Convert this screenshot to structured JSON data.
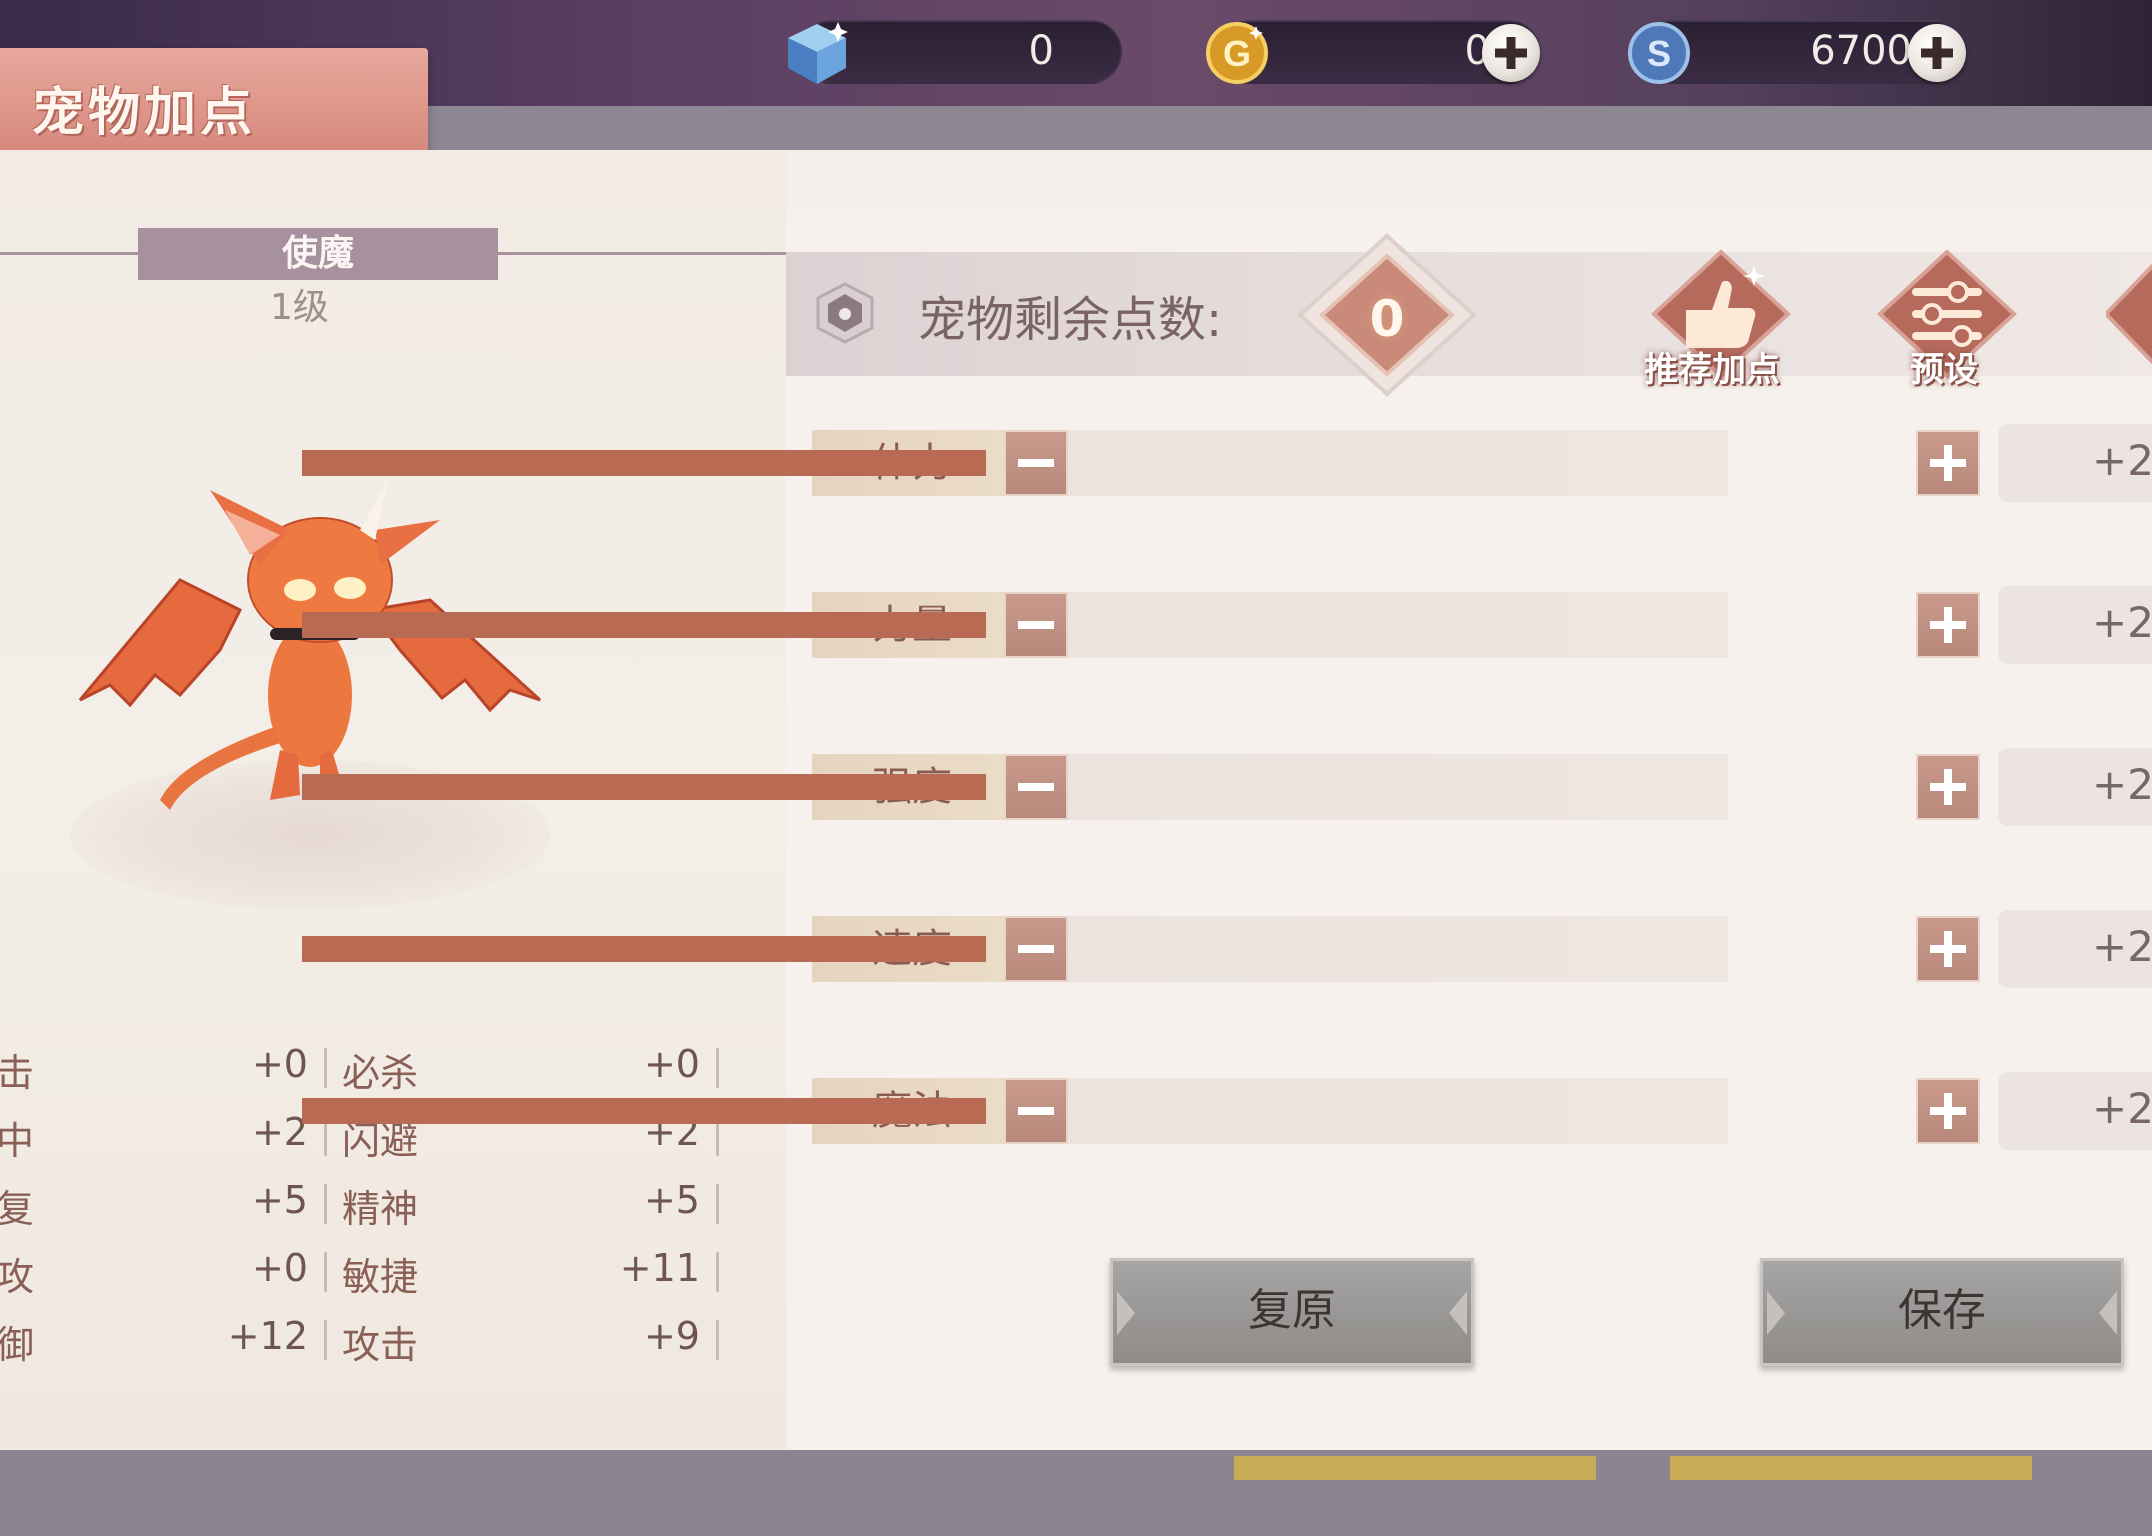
{
  "header": {
    "title": "宠物加点"
  },
  "currencies": [
    {
      "icon": "diamond-cube-icon",
      "value": "0",
      "has_plus": false
    },
    {
      "icon": "gold-coin-icon",
      "value": "0",
      "has_plus": true
    },
    {
      "icon": "silver-coin-icon",
      "value": "6700",
      "has_plus": true
    }
  ],
  "pet": {
    "name": "使魔",
    "level": "1级"
  },
  "stats": [
    {
      "left_label": "击",
      "left_value": "+0",
      "right_label": "必杀",
      "right_value": "+0"
    },
    {
      "left_label": "中",
      "left_value": "+2",
      "right_label": "闪避",
      "right_value": "+2"
    },
    {
      "left_label": "复",
      "left_value": "+5",
      "right_label": "精神",
      "right_value": "+5"
    },
    {
      "left_label": "攻",
      "left_value": "+0",
      "right_label": "敏捷",
      "right_value": "+11"
    },
    {
      "left_label": "御",
      "left_value": "+12",
      "right_label": "攻击",
      "right_value": "+9"
    }
  ],
  "points": {
    "label": "宠物剩余点数:",
    "value": "0"
  },
  "actions": {
    "recommend_label": "推荐加点",
    "preset_label": "预设"
  },
  "attributes": [
    {
      "label": "体力",
      "bonus": "+2"
    },
    {
      "label": "力量",
      "bonus": "+2"
    },
    {
      "label": "强度",
      "bonus": "+2"
    },
    {
      "label": "速度",
      "bonus": "+2"
    },
    {
      "label": "魔法",
      "bonus": "+2"
    }
  ],
  "buttons": {
    "reset_label": "复原",
    "save_label": "保存"
  },
  "colors": {
    "accent": "#b86b52",
    "title_tab": "#d98c80",
    "name_plate": "#a8919e"
  }
}
